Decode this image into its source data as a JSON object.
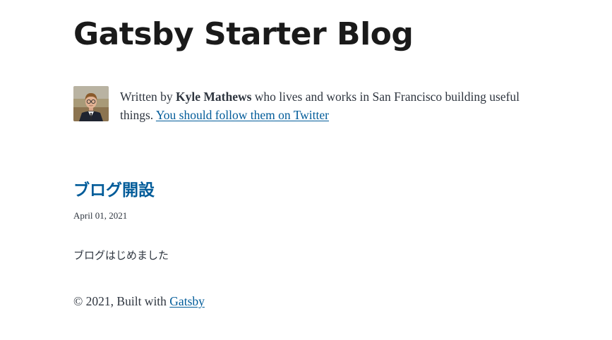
{
  "header": {
    "site_title": "Gatsby Starter Blog"
  },
  "bio": {
    "avatar_icon": "profile-photo-icon",
    "written_by": "Written by ",
    "author_name": "Kyle Mathews",
    "description": " who lives and works in San Francisco building useful things. ",
    "twitter_link": "You should follow them on Twitter"
  },
  "posts": [
    {
      "title": "ブログ開設",
      "date": "April 01, 2021",
      "excerpt": "ブログはじめました"
    }
  ],
  "footer": {
    "copyright": "© 2021, Built with ",
    "gatsby_link": "Gatsby"
  },
  "colors": {
    "link": "#005b99",
    "text": "#2e353f",
    "title": "#1a1a1a"
  }
}
